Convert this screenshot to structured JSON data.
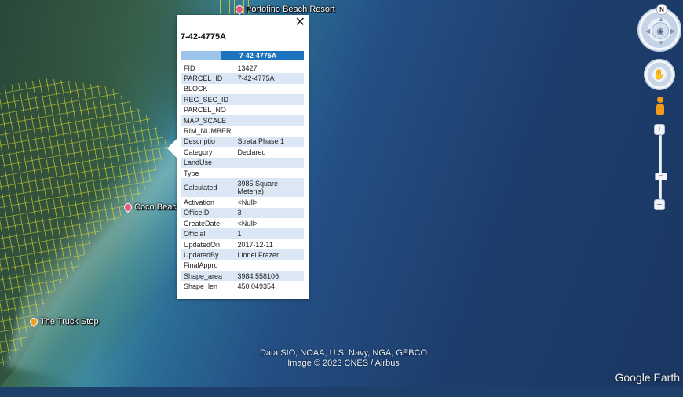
{
  "map": {
    "pois": [
      {
        "label": "Portofino Beach Resort",
        "pin": "pink-pin-icon"
      },
      {
        "label": "Coco Beach",
        "pin": "pink-pin-icon"
      },
      {
        "label": "The Truck Stop",
        "pin": "orange-pin-icon"
      }
    ],
    "credits_line1": "Data SIO, NOAA, U.S. Navy, NGA, GEBCO",
    "credits_line2": "Image © 2023 CNES / Airbus",
    "brand": "Google Earth"
  },
  "controls": {
    "north_label": "N",
    "zoom_in": "+",
    "zoom_out": "−",
    "icons": [
      "compass-ring-icon",
      "look-joystick-icon",
      "move-hand-icon",
      "pegman-icon"
    ]
  },
  "popup": {
    "title": "7-42-4775A",
    "header": "7-42-4775A",
    "close_label": "✕",
    "rows": [
      {
        "key": "FID",
        "value": "13427"
      },
      {
        "key": "PARCEL_ID",
        "value": "7-42-4775A"
      },
      {
        "key": "BLOCK",
        "value": ""
      },
      {
        "key": "REG_SEC_ID",
        "value": ""
      },
      {
        "key": "PARCEL_NO",
        "value": ""
      },
      {
        "key": "MAP_SCALE",
        "value": ""
      },
      {
        "key": "RIM_NUMBER",
        "value": ""
      },
      {
        "key": "Descriptio",
        "value": "Strata Phase 1"
      },
      {
        "key": "Category",
        "value": "Declared"
      },
      {
        "key": "LandUse",
        "value": ""
      },
      {
        "key": "Type",
        "value": ""
      },
      {
        "key": "Calculated",
        "value": "3985 Square Meter(s)"
      },
      {
        "key": "Activation",
        "value": "<Null>"
      },
      {
        "key": "OfficeID",
        "value": "3"
      },
      {
        "key": "CreateDate",
        "value": "<Null>"
      },
      {
        "key": "Official",
        "value": "1"
      },
      {
        "key": "UpdatedOn",
        "value": "2017-12-11"
      },
      {
        "key": "UpdatedBy",
        "value": "Lionel Frazer"
      },
      {
        "key": "FinalAppro",
        "value": ""
      },
      {
        "key": "Shape_area",
        "value": "3984.558106"
      },
      {
        "key": "Shape_len",
        "value": "450.049354"
      }
    ]
  }
}
